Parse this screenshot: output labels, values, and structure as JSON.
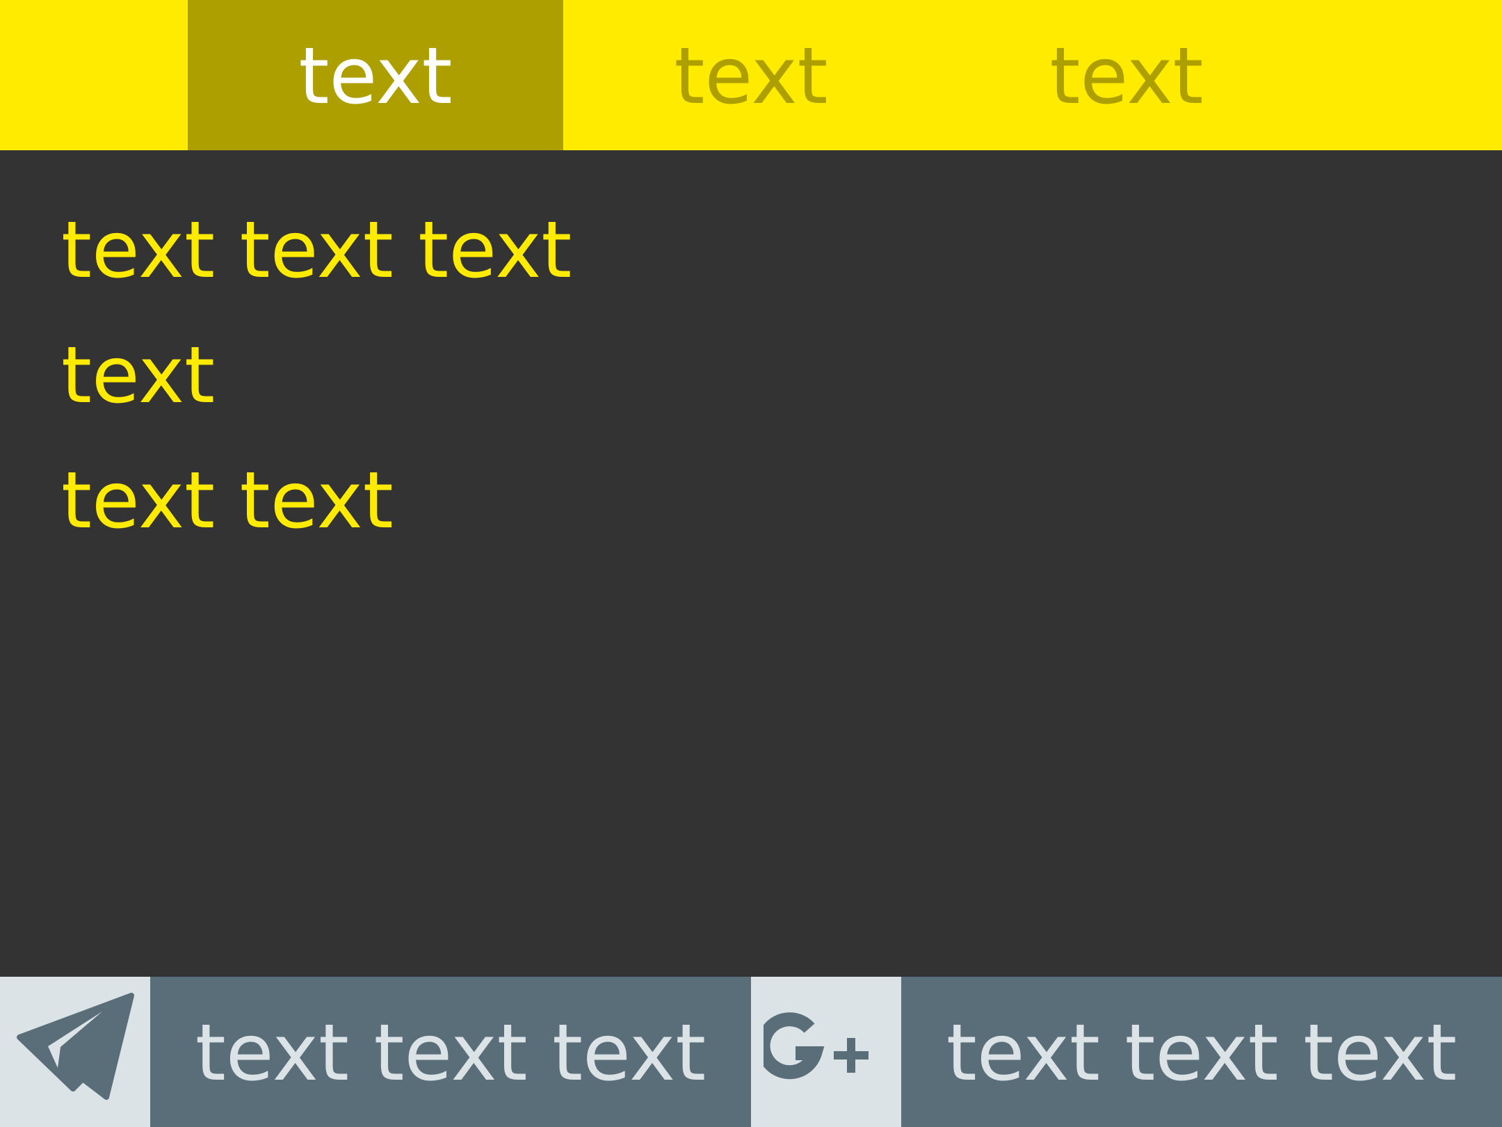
{
  "colors": {
    "accent": "#FFEB00",
    "accent_dark": "#AE9F00",
    "background": "#333333",
    "share_bar": "#5A6E7A",
    "share_icon_bg": "#DCE3E7"
  },
  "tabs": [
    {
      "label": "text",
      "active": true
    },
    {
      "label": "text",
      "active": false
    },
    {
      "label": "text",
      "active": false
    }
  ],
  "content": {
    "lines": [
      "text text text",
      "text",
      "text text"
    ]
  },
  "share": [
    {
      "icon": "telegram-icon",
      "label": "text text text"
    },
    {
      "icon": "google-plus-icon",
      "label": "text text text"
    }
  ]
}
